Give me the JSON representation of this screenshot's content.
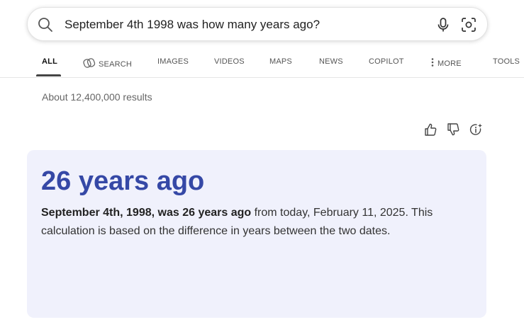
{
  "search": {
    "query": "September 4th 1998 was how many years ago?"
  },
  "tabs": [
    {
      "label": "ALL",
      "active": true
    },
    {
      "label": "SEARCH",
      "icon": "copilot-search-icon"
    },
    {
      "label": "IMAGES"
    },
    {
      "label": "VIDEOS"
    },
    {
      "label": "MAPS"
    },
    {
      "label": "NEWS"
    },
    {
      "label": "COPILOT"
    },
    {
      "label": "MORE",
      "icon": "more-vertical-icon"
    },
    {
      "label": "TOOLS"
    }
  ],
  "results": {
    "count_text": "About 12,400,000 results"
  },
  "feedback": {
    "icons": [
      "thumbs-up-icon",
      "thumbs-down-icon",
      "info-sparkle-icon"
    ]
  },
  "answer": {
    "title": "26 years ago",
    "bold_text": "September 4th, 1998, was 26 years ago",
    "rest_text": " from today, February 11, 2025. This calculation is based on the difference in years between the two dates.",
    "title_color": "#3548a6",
    "background_color": "#f0f1fc"
  }
}
